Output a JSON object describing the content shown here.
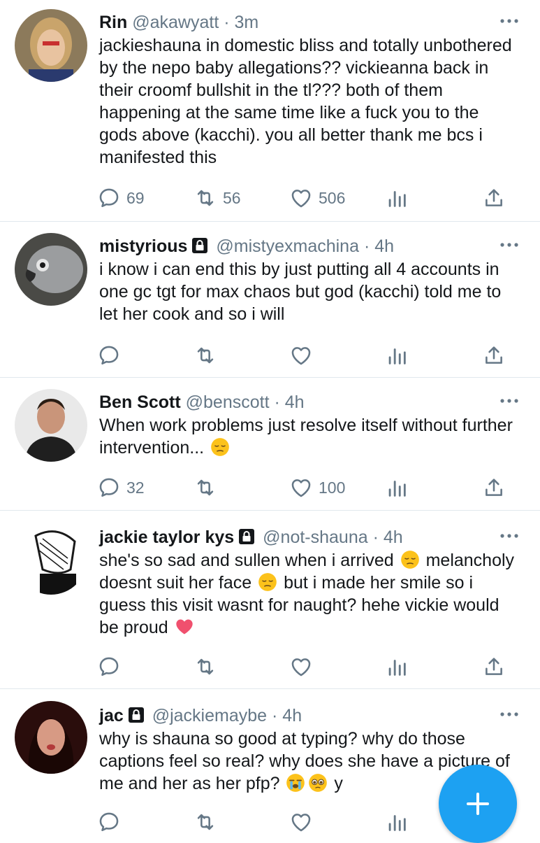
{
  "colors": {
    "accent": "#1da1f2",
    "muted": "#657786",
    "text": "#14171a",
    "heart": "#f0506e"
  },
  "tweets": [
    {
      "name": "Rin",
      "handle": "@akawyatt",
      "time": "· 3m",
      "locked": false,
      "text": "jackieshauna in domestic bliss and totally unbothered by the nepo baby allegations?? vickieanna back in their croomf bullshit in the tl??? both of them happening at the same time like a fuck you to the gods above (kacchi). you all better thank me bcs i manifested this",
      "replies": "69",
      "retweets": "56",
      "likes": "506"
    },
    {
      "name": "mistyrious",
      "handle": "@mistyexmachina",
      "time": "· 4h",
      "locked": true,
      "text": "i know i can end this by just putting all 4 accounts in one gc tgt for max chaos but god (kacchi) told me to let her cook and so i will",
      "replies": "",
      "retweets": "",
      "likes": ""
    },
    {
      "name": "Ben Scott",
      "handle": "@benscott",
      "time": "· 4h",
      "locked": false,
      "text": "When work problems just resolve itself without further intervention...",
      "replies": "32",
      "retweets": "",
      "likes": "100"
    },
    {
      "name": "jackie taylor kys",
      "handle": "@not-shauna",
      "time": "· 4h",
      "locked": true,
      "text_parts": [
        "she's so sad and sullen when i arrived",
        "melancholy doesnt suit her face",
        "but i made her smile so i guess this visit wasnt for naught? hehe vickie would be proud"
      ],
      "replies": "",
      "retweets": "",
      "likes": ""
    },
    {
      "name": "jac",
      "handle": "@jackiemaybe",
      "time": "· 4h",
      "locked": true,
      "text": "why is shauna so good at typing? why do those captions feel so real? why does she have a picture of me and her as her pfp?",
      "trail": "y",
      "replies": "",
      "retweets": "",
      "likes": ""
    }
  ],
  "icons": {
    "reply": "reply-icon",
    "retweet": "retweet-icon",
    "like": "heart-icon",
    "analytics": "analytics-icon",
    "share": "share-icon",
    "more": "more-icon",
    "lock": "lock-icon",
    "compose": "compose-plus-icon"
  }
}
